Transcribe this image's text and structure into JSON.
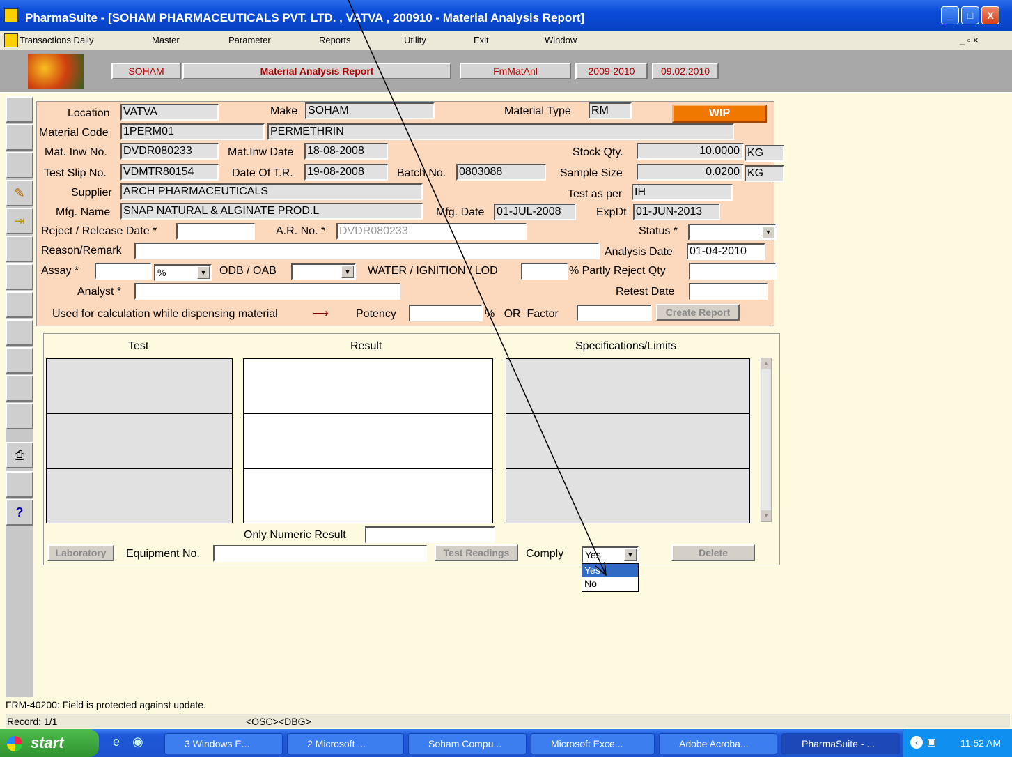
{
  "window": {
    "title": "PharmaSuite - [SOHAM PHARMACEUTICALS PVT. LTD. , VATVA , 200910 - Material Analysis Report]",
    "controls": [
      "_",
      "□",
      "X"
    ]
  },
  "menu": [
    "Transactions Daily",
    "Master",
    "Parameter",
    "Reports",
    "Utility",
    "Exit",
    "Window"
  ],
  "mdi_controls": "_ ▫ ×",
  "header": {
    "company": "SOHAM",
    "form_title": "Material Analysis Report",
    "form_code": "FmMatAnl",
    "year": "2009-2010",
    "date": "09.02.2010"
  },
  "toolbar_icons": [
    "blank",
    "blank",
    "blank",
    "pencil-icon",
    "exit-icon",
    "blank",
    "blank",
    "blank",
    "blank",
    "blank",
    "blank",
    "blank",
    "print-icon",
    "blank",
    "help-icon"
  ],
  "form": {
    "location_label": "Location",
    "location": "VATVA",
    "make_label": "Make",
    "make": "SOHAM",
    "material_type_label": "Material Type",
    "material_type": "RM",
    "status_button": "WIP",
    "material_code_label": "Material Code",
    "material_code": "1PERM01",
    "material_name": "PERMETHRIN",
    "mat_inw_no_label": "Mat. Inw No.",
    "mat_inw_no": "DVDR080233",
    "mat_inw_date_label": "Mat.Inw Date",
    "mat_inw_date": "18-08-2008",
    "stock_qty_label": "Stock Qty.",
    "stock_qty": "10.0000",
    "stock_unit": "KG",
    "test_slip_label": "Test Slip No.",
    "test_slip_no": "VDMTR80154",
    "date_tr_label": "Date Of T.R.",
    "date_tr": "19-08-2008",
    "batch_label": "Batch No.",
    "batch_no": "0803088",
    "sample_size_label": "Sample Size",
    "sample_size": "0.0200",
    "sample_unit": "KG",
    "supplier_label": "Supplier",
    "supplier": "ARCH PHARMACEUTICALS",
    "test_as_per_label": "Test as per",
    "test_as_per": "IH",
    "mfg_name_label": "Mfg. Name",
    "mfg_name": "SNAP NATURAL & ALGINATE PROD.L",
    "mfg_date_label": "Mfg. Date",
    "mfg_date": "01-JUL-2008",
    "expdt_label": "ExpDt",
    "expdt": "01-JUN-2013",
    "reject_release_label": "Reject / Release Date *",
    "reject_release_date": "",
    "ar_no_label": "A.R. No. *",
    "ar_no": "DVDR080233",
    "status_label": "Status *",
    "status": "",
    "reason_label": "Reason/Remark",
    "reason": "",
    "analysis_date_label": "Analysis Date",
    "analysis_date": "01-04-2010",
    "assay_label": "Assay *",
    "assay": "",
    "assay_unit": "%",
    "odb_label": "ODB / OAB",
    "odb": "",
    "water_label": "WATER / IGNITION / LOD",
    "water": "",
    "partly_reject_label": "% Partly Reject Qty",
    "partly_reject": "",
    "analyst_label": "Analyst *",
    "analyst": "",
    "retest_label": "Retest Date",
    "retest": "",
    "dispensing_note": "Used for calculation while dispensing material",
    "potency_label": "Potency",
    "potency": "",
    "pct_or_label": "%   OR  Factor",
    "factor": "",
    "create_report_button": "Create Report"
  },
  "grid": {
    "headers": [
      "Test",
      "Result",
      "Specifications/Limits"
    ],
    "numeric_label": "Only Numeric Result",
    "numeric_value": "",
    "laboratory_button": "Laboratory",
    "equipment_label": "Equipment No.",
    "equipment": "",
    "test_readings_button": "Test Readings",
    "comply_label": "Comply",
    "comply_value": "Yes",
    "comply_options": [
      "Yes",
      "No"
    ],
    "delete_button": "Delete"
  },
  "status": {
    "message": "FRM-40200: Field is protected against update.",
    "record": "Record: 1/1",
    "osc": "<OSC>",
    "dbg": "<DBG>"
  },
  "taskbar": {
    "start": "start",
    "tasks": [
      "3 Windows E...",
      "2 Microsoft ...",
      "Soham Compu...",
      "Microsoft Exce...",
      "Adobe Acroba...",
      "PharmaSuite - ..."
    ],
    "clock": "11:52 AM"
  }
}
